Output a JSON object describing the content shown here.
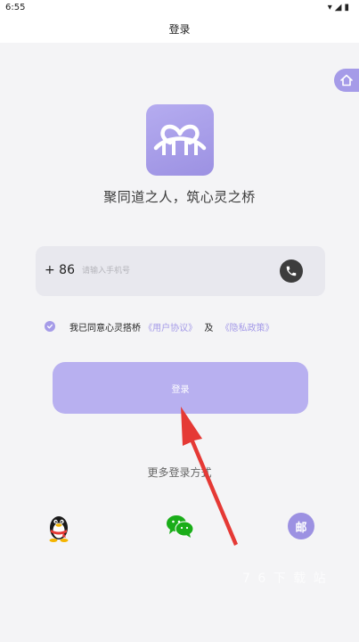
{
  "status_bar": {
    "time": "6:55",
    "icons": "▾◢▮"
  },
  "top_bar": {
    "title": "登录"
  },
  "slogan": "聚同道之人，筑心灵之桥",
  "phone": {
    "country_code": "+ 86",
    "placeholder": "请输入手机号"
  },
  "agreement": {
    "prefix": "我已同意心灵搭桥",
    "user_agreement": "《用户协议》",
    "and": "及",
    "privacy_policy": "《隐私政策》",
    "checked": true
  },
  "login_button_label": "登录",
  "more_login_label": "更多登录方式",
  "email_label": "邮",
  "watermark": "7 6 下 载 站",
  "colors": {
    "accent": "#a59be8",
    "button": "#b8b0f0",
    "arrow": "#e53935"
  }
}
